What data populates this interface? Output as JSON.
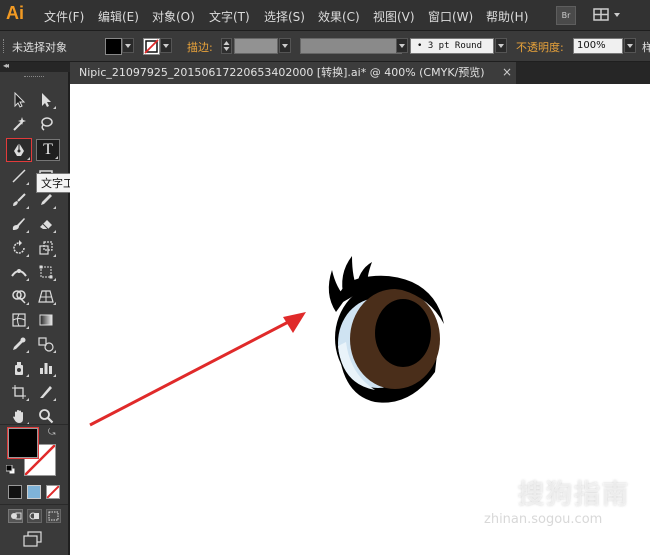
{
  "app": {
    "logo": "Ai"
  },
  "menu": [
    "文件(F)",
    "编辑(E)",
    "对象(O)",
    "文字(T)",
    "选择(S)",
    "效果(C)",
    "视图(V)",
    "窗口(W)",
    "帮助(H)"
  ],
  "menubar": {
    "bridge_label": "Br"
  },
  "control_bar": {
    "selection_status": "未选择对象",
    "stroke_label": "描边:",
    "stroke_style": "• 3 pt Round",
    "opacity_label": "不透明度:",
    "opacity_value": "100%",
    "style_label": "样"
  },
  "document_tab": {
    "title": "Nipic_21097925_20150617220653402000 [转换].ai* @ 400% (CMYK/预览)",
    "close": "×"
  },
  "tooltip": {
    "text": "文字工具 (T)"
  },
  "tools": {
    "type_label": "T"
  },
  "watermark": {
    "text": "搜狗指南",
    "url": "zhinan.sogou.com"
  },
  "colors": {
    "accent_orange": "#f29a23",
    "arrow_red": "#e02a2a",
    "iris_brown": "#4a2e1a",
    "sclera_blue": "#cfe3f2"
  }
}
